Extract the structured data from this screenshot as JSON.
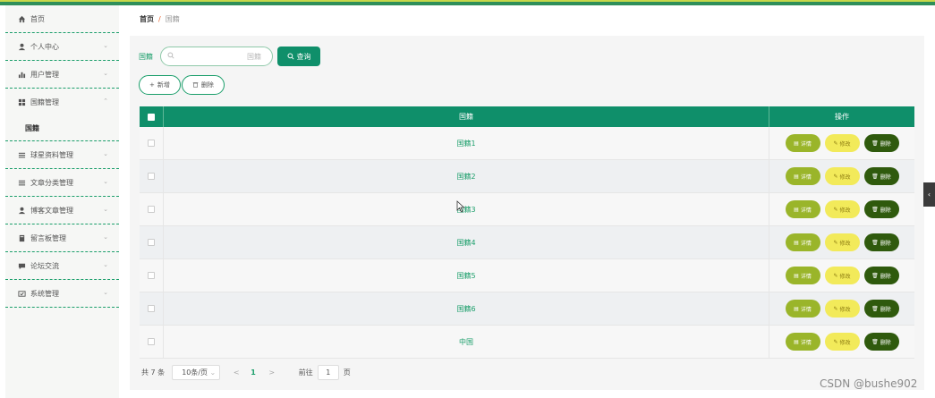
{
  "colors": {
    "primary": "#0f8f6a",
    "detail": "#9ab52a",
    "edit": "#f2ea5a",
    "delete": "#2f5a0d"
  },
  "sidebar": {
    "items": [
      {
        "label": "首页",
        "icon": "home-icon",
        "has_chevron": false
      },
      {
        "label": "个人中心",
        "icon": "user-icon",
        "has_chevron": true
      },
      {
        "label": "用户管理",
        "icon": "bar-chart-icon",
        "has_chevron": true
      },
      {
        "label": "国籍管理",
        "icon": "grid-icon",
        "has_chevron": true,
        "expanded": true,
        "sub": "国籍"
      },
      {
        "label": "球星资料管理",
        "icon": "list-icon",
        "has_chevron": true
      },
      {
        "label": "文章分类管理",
        "icon": "list-icon",
        "has_chevron": true
      },
      {
        "label": "博客文章管理",
        "icon": "user-icon",
        "has_chevron": true
      },
      {
        "label": "留言板管理",
        "icon": "book-icon",
        "has_chevron": true
      },
      {
        "label": "论坛交流",
        "icon": "chat-icon",
        "has_chevron": true
      },
      {
        "label": "系统管理",
        "icon": "settings-icon",
        "has_chevron": true
      }
    ]
  },
  "breadcrumb": {
    "home": "首页",
    "separator": "/",
    "current": "国籍"
  },
  "search": {
    "label": "国籍",
    "placeholder": "国籍",
    "value": "",
    "button": "查询"
  },
  "actions": {
    "add": "新增",
    "delete": "删除"
  },
  "table": {
    "headers": {
      "name": "国籍",
      "ops": "操作"
    },
    "rows": [
      {
        "name": "国籍1"
      },
      {
        "name": "国籍2"
      },
      {
        "name": "国籍3"
      },
      {
        "name": "国籍4"
      },
      {
        "name": "国籍5"
      },
      {
        "name": "国籍6"
      },
      {
        "name": "中国"
      }
    ],
    "row_ops": {
      "detail": "详情",
      "edit": "修改",
      "delete": "删除"
    }
  },
  "pager": {
    "total": "共 7 条",
    "page_size": "10条/页",
    "prev": "<",
    "current": "1",
    "next": ">",
    "goto": "前往",
    "goto_value": "1",
    "page_unit": "页"
  },
  "watermark": "CSDN @bushe902"
}
